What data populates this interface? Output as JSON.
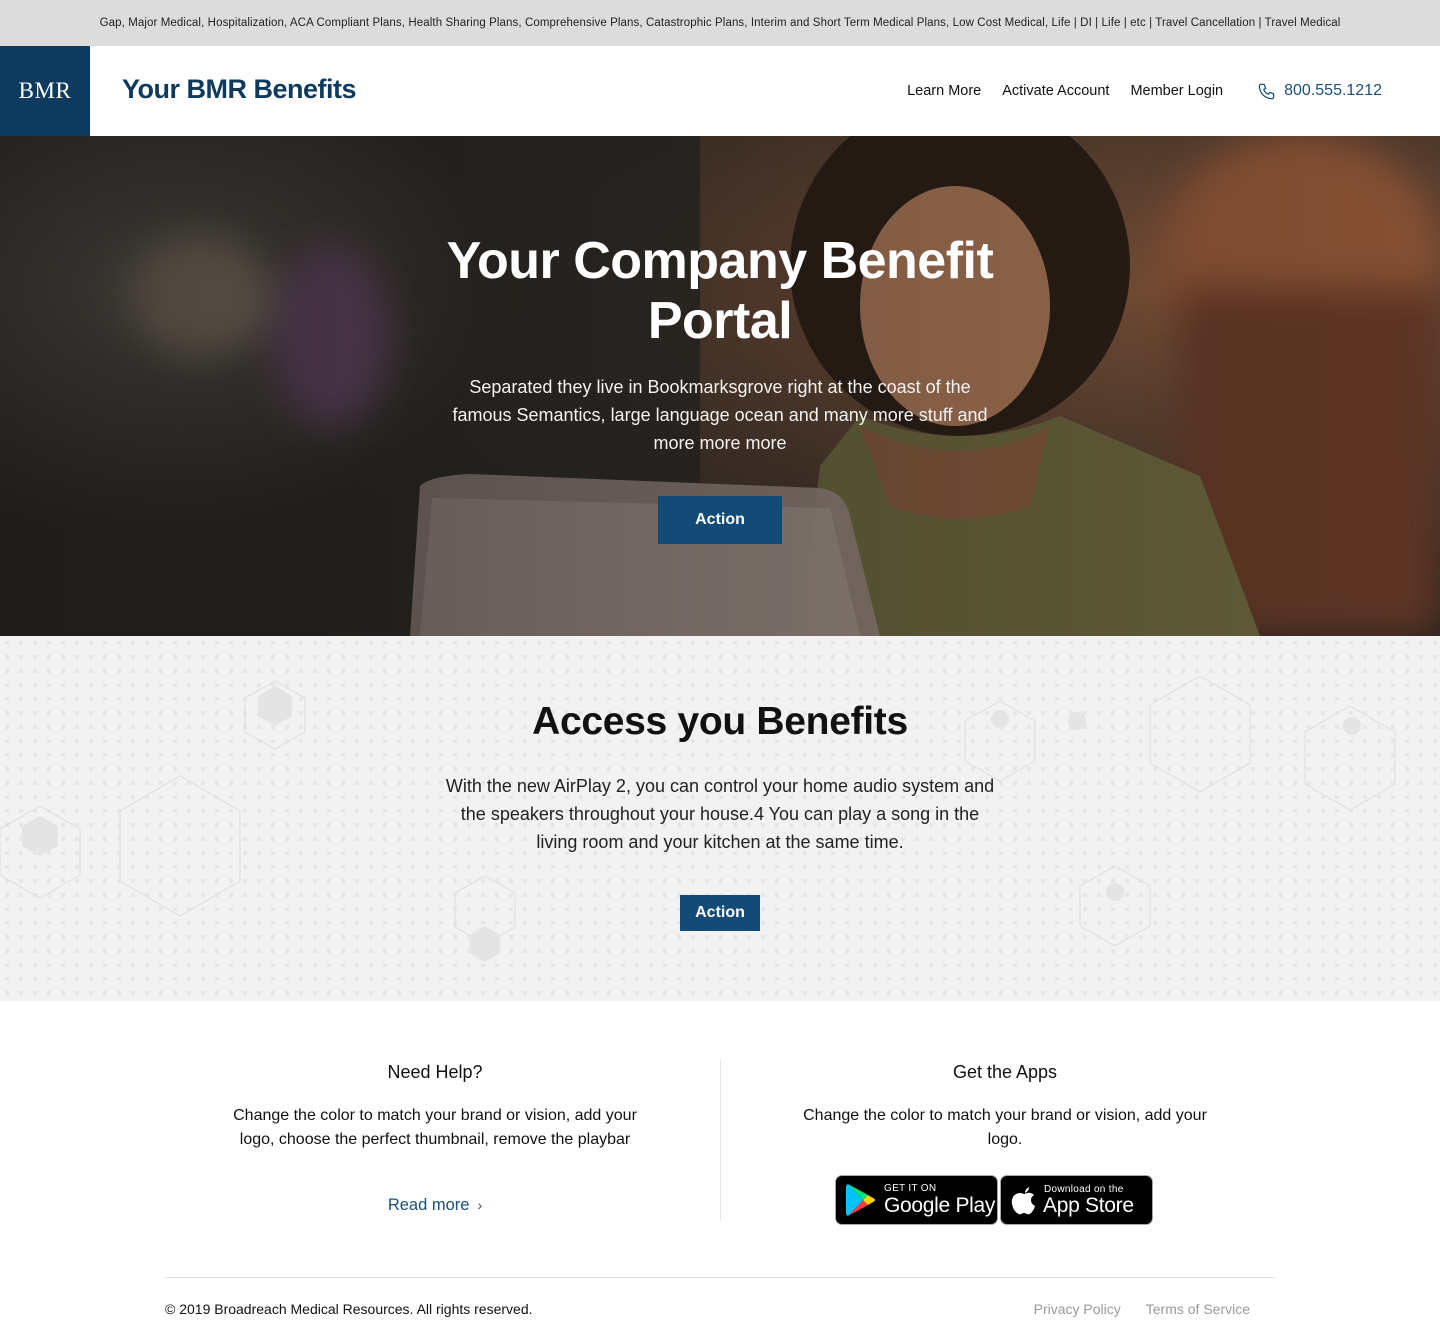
{
  "topbar": {
    "text": "Gap, Major Medical, Hospitalization, ACA Compliant Plans, Health Sharing Plans, Comprehensive Plans,  Catastrophic Plans, Interim and Short Term Medical Plans, Low Cost Medical, Life | DI | Life | etc | Travel Cancellation | Travel Medical"
  },
  "header": {
    "logo": "BMR",
    "brand": "Your BMR Benefits",
    "nav": [
      "Learn More",
      "Activate Account",
      "Member Login"
    ],
    "phone": "800.555.1212",
    "phone_icon": "phone-icon"
  },
  "hero": {
    "title": "Your Company Benefit Portal",
    "subtitle": "Separated they live in Bookmarksgrove right at the coast of the famous Semantics, large language ocean and many more stuff and more more more",
    "button": "Action"
  },
  "access": {
    "title": "Access you Benefits",
    "text": "With the new AirPlay 2, you can control your home audio system and the speakers throughout your house.4 You can play a song in the living room and your kitchen at the same time.",
    "button": "Action"
  },
  "help": {
    "title": "Need Help?",
    "text": "Change the color to match your brand or vision, add your logo, choose the perfect thumbnail, remove the playbar",
    "link": "Read more",
    "link_icon": "chevron-right-icon"
  },
  "apps": {
    "title": "Get the Apps",
    "text": "Change the color to match your brand or vision, add your logo.",
    "google_small": "GET IT ON",
    "google_big": "Google Play",
    "apple_small": "Download on the",
    "apple_big": "App Store"
  },
  "footer": {
    "copyright": "© 2019 Broadreach Medical Resources. All rights reserved.",
    "links": [
      "Privacy Policy",
      "Terms of Service"
    ]
  },
  "colors": {
    "brand_navy": "#0d3a5e",
    "button_blue": "#124a78",
    "link_blue": "#1a4f7a"
  }
}
